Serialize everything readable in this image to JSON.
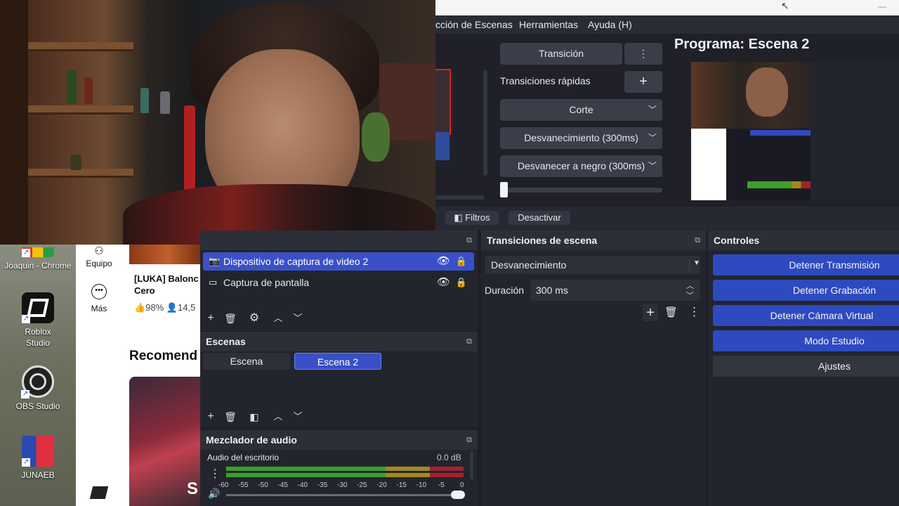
{
  "obs": {
    "menu": [
      "cción de Escenas",
      "Herramientas",
      "Ayuda (H)"
    ],
    "studio": {
      "transition_button": "Transición",
      "quick_transitions_label": "Transiciones rápidas",
      "quick_items": [
        "Corte",
        "Desvanecimiento (300ms)",
        "Desvanecer a negro (300ms)"
      ]
    },
    "program_title": "Programa: Escena 2",
    "filter_bar": {
      "filters_label": "Filtros",
      "deactivate_label": "Desactivar"
    },
    "sources": {
      "items": [
        {
          "label": "Dispositivo de captura de video 2",
          "icon": "camera-icon",
          "selected": true
        },
        {
          "label": "Captura de pantalla",
          "icon": "monitor-icon",
          "selected": false
        }
      ]
    },
    "scenes": {
      "title": "Escenas",
      "items": [
        {
          "label": "Escena",
          "selected": false
        },
        {
          "label": "Escena 2",
          "selected": true
        }
      ]
    },
    "audio_mixer": {
      "title": "Mezclador de audio",
      "channel": "Audio del escritorio",
      "level": "0.0 dB",
      "scale": [
        "-60",
        "-55",
        "-50",
        "-45",
        "-40",
        "-35",
        "-30",
        "-25",
        "-20",
        "-15",
        "-10",
        "-5",
        "0"
      ],
      "volume_fraction": 1.0
    },
    "scene_transitions": {
      "title": "Transiciones de escena",
      "selected": "Desvanecimiento",
      "duration_label": "Duración",
      "duration_value": "300 ms"
    },
    "controls": {
      "title": "Controles",
      "buttons": [
        "Detener Transmisión",
        "Detener Grabación",
        "Detener Cámara Virtual",
        "Modo Estudio",
        "Ajustes"
      ]
    }
  },
  "desktop": {
    "icons": [
      {
        "label": "Joaquin - Chrome",
        "icon": "chrome-icon"
      },
      {
        "label": "Roblox Studio",
        "icon": "roblox-studio-icon"
      },
      {
        "label": "OBS Studio",
        "icon": "obs-icon"
      },
      {
        "label": "JUNAEB",
        "icon": "junaeb-icon"
      }
    ]
  },
  "browser": {
    "sidebar": [
      "Equipo",
      "Más"
    ],
    "video_title": "[LUKA] Balonc Cero",
    "video_stats": "👍98%  👤14,5",
    "recommended_heading": "Recomend",
    "thumb_caption": "S"
  },
  "colors": {
    "accent_blue": "#2e4ac0",
    "selection_blue": "#3a50c8",
    "meter_green": "#3aa02c",
    "meter_yellow": "#a08a1e",
    "meter_red": "#a8202e"
  }
}
